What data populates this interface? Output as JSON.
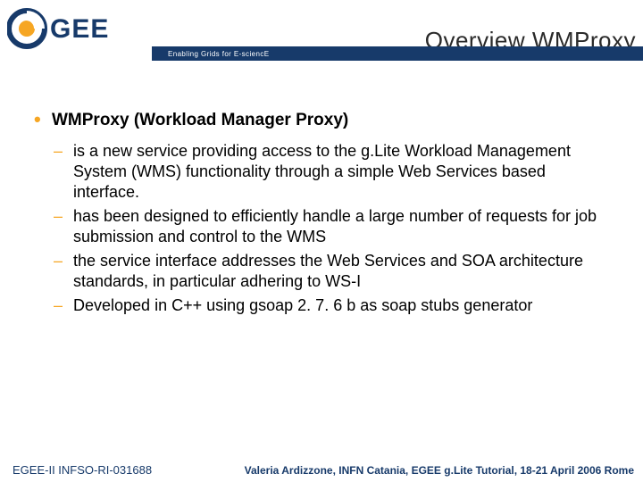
{
  "header": {
    "title": "Overview WMProxy",
    "tagline": "Enabling Grids for E-sciencE"
  },
  "body": {
    "heading": "WMProxy (Workload Manager Proxy)",
    "points": [
      "is a new service providing access to the g.Lite Workload Management System (WMS) functionality through a simple Web Services based interface.",
      "has been designed to efficiently handle a large number of requests for job submission and control to the WMS",
      "the service interface addresses the Web Services and SOA architecture standards, in particular adhering  to WS-I",
      "Developed in C++ using gsoap 2. 7. 6 b as soap stubs generator"
    ]
  },
  "footer": {
    "left": "EGEE-II INFSO-RI-031688",
    "right": "Valeria Ardizzone, INFN Catania, EGEE g.Lite Tutorial, 18-21 April 2006 Rome"
  }
}
